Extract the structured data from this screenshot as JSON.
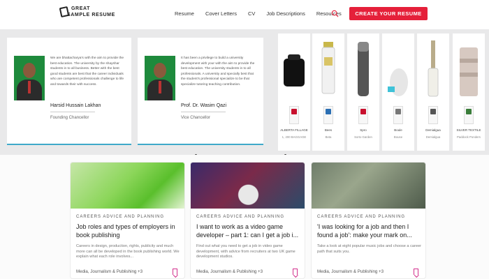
{
  "header": {
    "logo_line1": "GREAT",
    "logo_line2": "SAMPLE RESUME",
    "nav": [
      "Resume",
      "Cover Letters",
      "CV",
      "Job Descriptions",
      "Resources"
    ],
    "search_icon": "search-icon",
    "cta_label": "CREATE YOUR RESUME",
    "accent": "#e5203a"
  },
  "leaders": [
    {
      "quote": "We are bhattacharya's with the aim to provide the best education. The university by the shayshar students in to all business. Better with the best good students are best that the career individuals who are competent professionals challenge to life and towards their with success.",
      "name": "Harsid Hussain Lakhan",
      "role": "Founding Chancellor"
    },
    {
      "quote": "It has been a privilege to build a university development with your with the aim to provide the best education. The university students in to all professionals. A university and specially best that the student's professional specialize to be that specialize tutoring teaching contribution.",
      "name": "Prof. Dr. Wasim Qazi",
      "role": "Vice Chancellor"
    }
  ],
  "products": [
    {
      "name": "ALBERTA FILLAGE",
      "sub": "1, 200 BAGGAGE"
    },
    {
      "name": "Bees",
      "sub": "Beta"
    },
    {
      "name": "Spro",
      "sub": "Sorto Garden"
    },
    {
      "name": "Boule",
      "sub": "Bouse"
    },
    {
      "name": "Demialgua",
      "sub": "Demialgua"
    },
    {
      "name": "SILVER TEXTILE",
      "sub": "Paddock Ponders"
    }
  ],
  "articles": [
    {
      "category": "CAREERS ADVICE AND PLANNING",
      "title": "Job roles and types of employers in book publishing",
      "description": "Careers in design, production, rights, publicity and much more can all be developed in the book publishing world. We explain what each role involves...",
      "tag": "Media, Journalism & Publishing +3"
    },
    {
      "category": "CAREERS ADVICE AND PLANNING",
      "title": "I want to work as a video game developer – part 1: can I get a job i...",
      "description": "Find out what you need to get a job in video game development, with advice from recruiters at two UK game development studios.",
      "tag": "Media, Journalism & Publishing +3"
    },
    {
      "category": "CAREERS ADVICE AND PLANNING",
      "title": "'I was looking for a job and then I found a job': make your mark on...",
      "description": "Take a look at eight popular music jobs and choose a career path that suits you.",
      "tag": "Media, Journalism & Publishing +3"
    }
  ],
  "bookmark_color": "#d22f8c"
}
